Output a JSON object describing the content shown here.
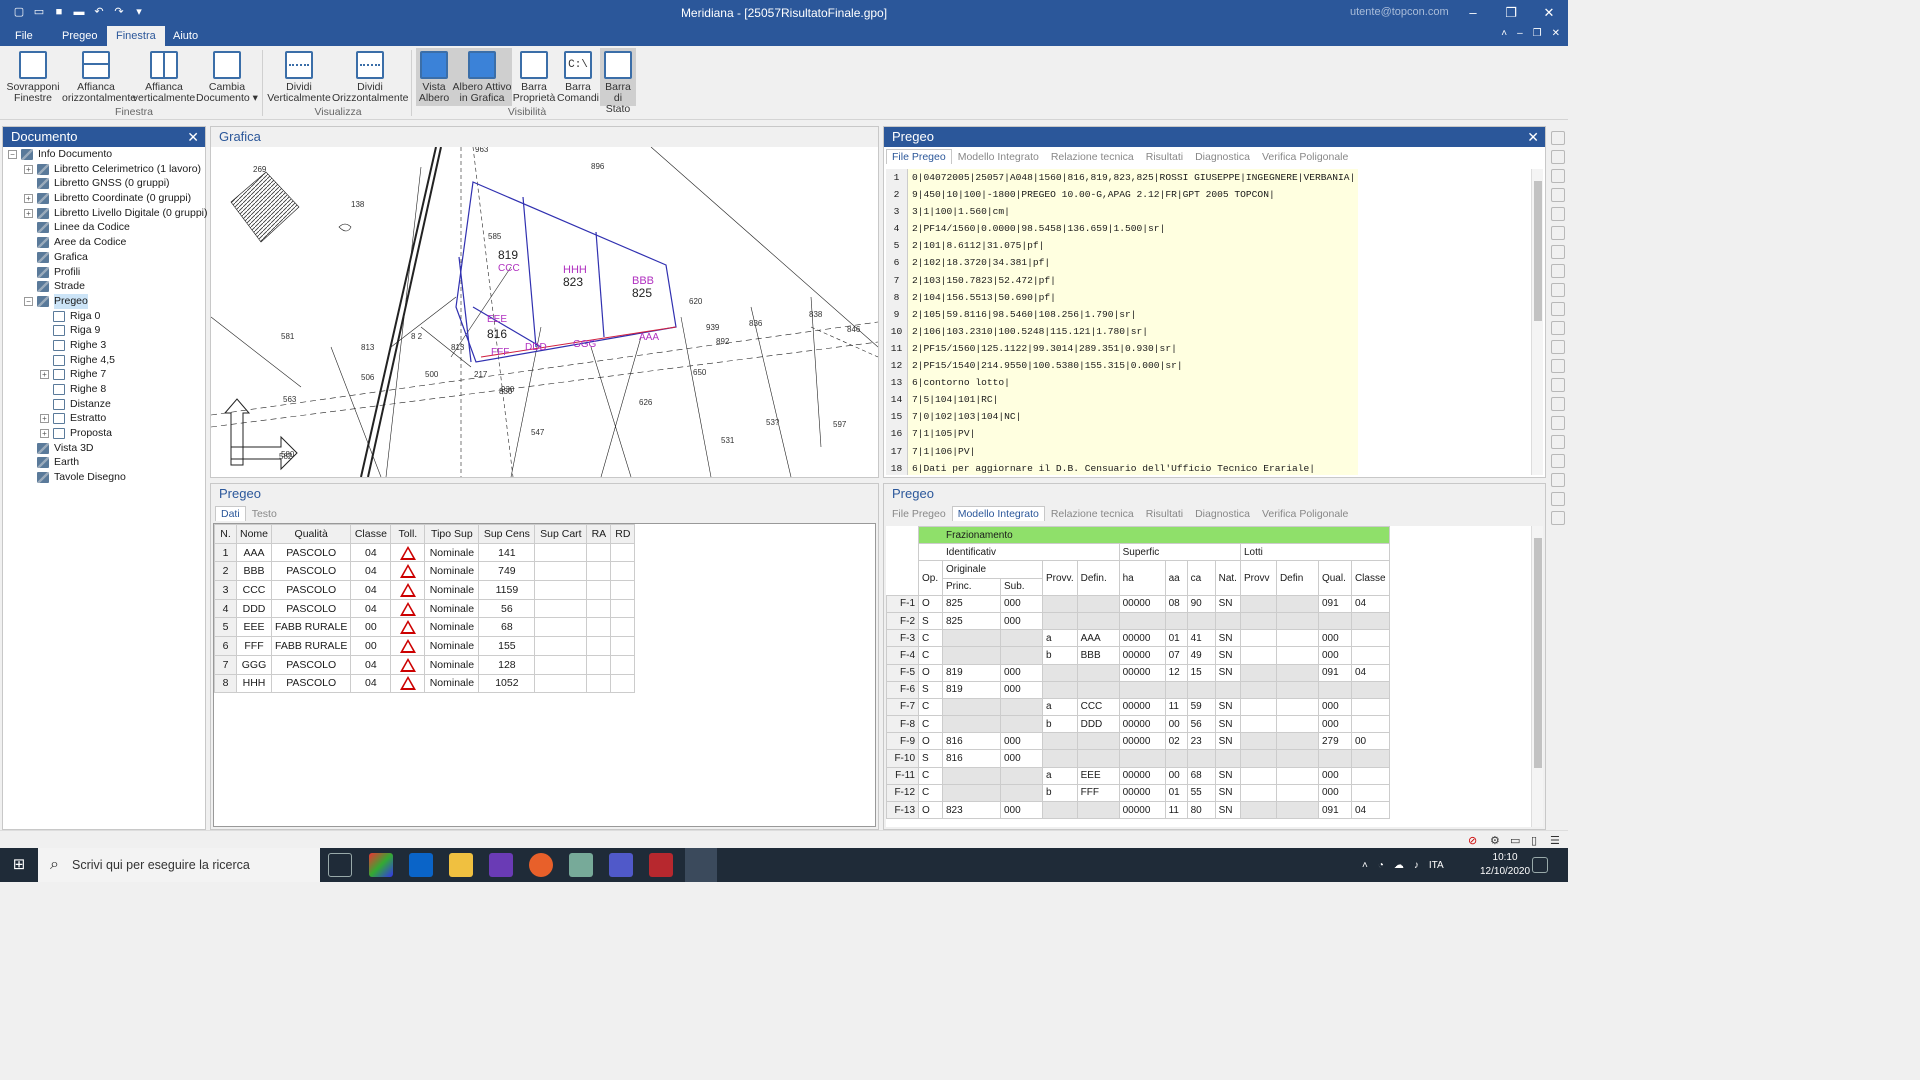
{
  "window": {
    "title": "Meridiana - [25057RisultatoFinale.gpo]",
    "user": "utente@topcon.com"
  },
  "menu": {
    "tabs": [
      "File",
      "Pregeo",
      "Finestra",
      "Aiuto"
    ]
  },
  "ribbon": {
    "buttons": [
      {
        "label": "Sovrapponi\nFinestre"
      },
      {
        "label": "Affianca\norizzontalmente"
      },
      {
        "label": "Affianca\nverticalmente"
      },
      {
        "label": "Cambia\nDocumento ▾"
      },
      {
        "label": "Dividi\nVerticalmente"
      },
      {
        "label": "Dividi\nOrizzontalmente"
      },
      {
        "label": "Vista\nAlbero"
      },
      {
        "label": "Albero Attivo\nin Grafica"
      },
      {
        "label": "Barra\nProprietà"
      },
      {
        "label": "Barra\nComandi"
      },
      {
        "label": "Barra di\nStato"
      }
    ],
    "groups": [
      "Finestra",
      "Visualizza",
      "Visibilità"
    ],
    "cmd_icon_text": "C:\\"
  },
  "document_panel": {
    "title": "Documento",
    "tree": [
      {
        "label": "Info Documento",
        "level": 0,
        "toggle": "−"
      },
      {
        "label": "Libretto Celerimetrico (1 lavoro)",
        "level": 1,
        "toggle": "+"
      },
      {
        "label": "Libretto GNSS (0 gruppi)",
        "level": 1,
        "toggle": ""
      },
      {
        "label": "Libretto Coordinate (0 gruppi)",
        "level": 1,
        "toggle": "+"
      },
      {
        "label": "Libretto Livello Digitale (0 gruppi)",
        "level": 1,
        "toggle": "+"
      },
      {
        "label": "Linee da Codice",
        "level": 1,
        "toggle": ""
      },
      {
        "label": "Aree da Codice",
        "level": 1,
        "toggle": ""
      },
      {
        "label": "Grafica",
        "level": 1,
        "toggle": ""
      },
      {
        "label": "Profili",
        "level": 1,
        "toggle": ""
      },
      {
        "label": "Strade",
        "level": 1,
        "toggle": ""
      },
      {
        "label": "Pregeo",
        "level": 1,
        "toggle": "−",
        "selected": true
      },
      {
        "label": "Riga 0",
        "level": 2,
        "toggle": ""
      },
      {
        "label": "Riga 9",
        "level": 2,
        "toggle": ""
      },
      {
        "label": "Righe 3",
        "level": 2,
        "toggle": ""
      },
      {
        "label": "Righe 4,5",
        "level": 2,
        "toggle": ""
      },
      {
        "label": "Righe 7",
        "level": 2,
        "toggle": "+"
      },
      {
        "label": "Righe 8",
        "level": 2,
        "toggle": ""
      },
      {
        "label": "Distanze",
        "level": 2,
        "toggle": ""
      },
      {
        "label": "Estratto",
        "level": 2,
        "toggle": "+"
      },
      {
        "label": "Proposta",
        "level": 2,
        "toggle": "+"
      },
      {
        "label": "Vista 3D",
        "level": 1,
        "toggle": ""
      },
      {
        "label": "Earth",
        "level": 1,
        "toggle": ""
      },
      {
        "label": "Tavole Disegno",
        "level": 1,
        "toggle": ""
      }
    ]
  },
  "grafica": {
    "title": "Grafica",
    "parcels": [
      "819",
      "823",
      "825",
      "816"
    ],
    "parcel_labels": [
      "CCC",
      "HHH",
      "BBB",
      "EEE",
      "FFF",
      "DDD",
      "GGG",
      "AAA"
    ],
    "map_numbers": [
      "269",
      "138",
      "563",
      "963",
      "581",
      "580",
      "813",
      "506",
      "585",
      "500",
      "813",
      "896",
      "930",
      "620",
      "939",
      "836",
      "838",
      "846",
      "650",
      "626",
      "547",
      "531",
      "53?",
      "597",
      "582",
      "892",
      "217",
      "830",
      "8 2"
    ]
  },
  "pregeo_left": {
    "title": "Pregeo",
    "tabs": [
      "Dati",
      "Testo"
    ],
    "columns": [
      "N.",
      "Nome",
      "Qualità",
      "Classe",
      "Toll.",
      "Tipo Sup",
      "Sup Cens",
      "Sup Cart",
      "RA",
      "RD"
    ],
    "rows": [
      {
        "n": "1",
        "nome": "AAA",
        "qualita": "PASCOLO",
        "classe": "04",
        "tipo": "Nominale",
        "sup": "141"
      },
      {
        "n": "2",
        "nome": "BBB",
        "qualita": "PASCOLO",
        "classe": "04",
        "tipo": "Nominale",
        "sup": "749"
      },
      {
        "n": "3",
        "nome": "CCC",
        "qualita": "PASCOLO",
        "classe": "04",
        "tipo": "Nominale",
        "sup": "1159"
      },
      {
        "n": "4",
        "nome": "DDD",
        "qualita": "PASCOLO",
        "classe": "04",
        "tipo": "Nominale",
        "sup": "56"
      },
      {
        "n": "5",
        "nome": "EEE",
        "qualita": "FABB RURALE",
        "classe": "00",
        "tipo": "Nominale",
        "sup": "68"
      },
      {
        "n": "6",
        "nome": "FFF",
        "qualita": "FABB RURALE",
        "classe": "00",
        "tipo": "Nominale",
        "sup": "155"
      },
      {
        "n": "7",
        "nome": "GGG",
        "qualita": "PASCOLO",
        "classe": "04",
        "tipo": "Nominale",
        "sup": "128"
      },
      {
        "n": "8",
        "nome": "HHH",
        "qualita": "PASCOLO",
        "classe": "04",
        "tipo": "Nominale",
        "sup": "1052"
      }
    ]
  },
  "pregeo_top": {
    "title": "Pregeo",
    "tabs": [
      "File Pregeo",
      "Modello Integrato",
      "Relazione tecnica",
      "Risultati",
      "Diagnostica",
      "Verifica Poligonale"
    ],
    "lines": [
      "0|04072005|25057|A048|1560|816,819,823,825|ROSSI GIUSEPPE|INGEGNERE|VERBANIA|",
      "9|450|10|100|-1800|PREGEO 10.00-G,APAG 2.12|FR|GPT 2005 TOPCON|",
      "3|1|100|1.560|cm|",
      "2|PF14/1560|0.0000|98.5458|136.659|1.500|sr|",
      "2|101|8.6112|31.075|pf|",
      "2|102|18.3720|34.381|pf|",
      "2|103|150.7823|52.472|pf|",
      "2|104|156.5513|50.690|pf|",
      "2|105|59.8116|98.5460|108.256|1.790|sr|",
      "2|106|103.2310|100.5248|115.121|1.780|sr|",
      "2|PF15/1560|125.1122|99.3014|289.351|0.930|sr|",
      "2|PF15/1540|214.9550|100.5380|155.315|0.000|sr|",
      "6|contorno lotto|",
      "7|5|104|101|RC|",
      "7|0|102|103|104|NC|",
      "7|1|105|PV|",
      "7|1|106|PV|",
      "6|Dati per aggiornare il D.B. Censuario dell'Ufficio Tecnico Erariale|"
    ]
  },
  "pregeo_bottom": {
    "title": "Pregeo",
    "tabs": [
      "File Pregeo",
      "Modello Integrato",
      "Relazione tecnica",
      "Risultati",
      "Diagnostica",
      "Verifica Poligonale"
    ],
    "header": {
      "frazionamento": "Frazionamento",
      "identificativ": "Identificativ",
      "superfic": "Superfic",
      "lotti": "Lotti",
      "op": "Op.",
      "originale": "Originale",
      "princ": "Princ.",
      "sub": "Sub.",
      "provv": "Provv.",
      "defin": "Defin.",
      "ha": "ha",
      "aa": "aa",
      "ca": "ca",
      "nat": "Nat.",
      "lprovv": "Provv",
      "ldefin": "Defin",
      "qual": "Qual.",
      "classe": "Classe"
    },
    "rows": [
      {
        "id": "F-1",
        "op": "O",
        "princ": "825",
        "sub": "000",
        "provv": "",
        "defin": "",
        "ha": "00000",
        "aa": "08",
        "ca": "90",
        "nat": "SN",
        "qual": "091",
        "classe": "04"
      },
      {
        "id": "F-2",
        "op": "S",
        "princ": "825",
        "sub": "000",
        "provv": "",
        "defin": "",
        "ha": "",
        "aa": "",
        "ca": "",
        "nat": "",
        "qual": "",
        "classe": ""
      },
      {
        "id": "F-3",
        "op": "C",
        "princ": "",
        "sub": "",
        "provv": "a",
        "defin": "AAA",
        "ha": "00000",
        "aa": "01",
        "ca": "41",
        "nat": "SN",
        "qual": "000",
        "classe": ""
      },
      {
        "id": "F-4",
        "op": "C",
        "princ": "",
        "sub": "",
        "provv": "b",
        "defin": "BBB",
        "ha": "00000",
        "aa": "07",
        "ca": "49",
        "nat": "SN",
        "qual": "000",
        "classe": ""
      },
      {
        "id": "F-5",
        "op": "O",
        "princ": "819",
        "sub": "000",
        "provv": "",
        "defin": "",
        "ha": "00000",
        "aa": "12",
        "ca": "15",
        "nat": "SN",
        "qual": "091",
        "classe": "04"
      },
      {
        "id": "F-6",
        "op": "S",
        "princ": "819",
        "sub": "000",
        "provv": "",
        "defin": "",
        "ha": "",
        "aa": "",
        "ca": "",
        "nat": "",
        "qual": "",
        "classe": ""
      },
      {
        "id": "F-7",
        "op": "C",
        "princ": "",
        "sub": "",
        "provv": "a",
        "defin": "CCC",
        "ha": "00000",
        "aa": "11",
        "ca": "59",
        "nat": "SN",
        "qual": "000",
        "classe": ""
      },
      {
        "id": "F-8",
        "op": "C",
        "princ": "",
        "sub": "",
        "provv": "b",
        "defin": "DDD",
        "ha": "00000",
        "aa": "00",
        "ca": "56",
        "nat": "SN",
        "qual": "000",
        "classe": ""
      },
      {
        "id": "F-9",
        "op": "O",
        "princ": "816",
        "sub": "000",
        "provv": "",
        "defin": "",
        "ha": "00000",
        "aa": "02",
        "ca": "23",
        "nat": "SN",
        "qual": "279",
        "classe": "00"
      },
      {
        "id": "F-10",
        "op": "S",
        "princ": "816",
        "sub": "000",
        "provv": "",
        "defin": "",
        "ha": "",
        "aa": "",
        "ca": "",
        "nat": "",
        "qual": "",
        "classe": ""
      },
      {
        "id": "F-11",
        "op": "C",
        "princ": "",
        "sub": "",
        "provv": "a",
        "defin": "EEE",
        "ha": "00000",
        "aa": "00",
        "ca": "68",
        "nat": "SN",
        "qual": "000",
        "classe": ""
      },
      {
        "id": "F-12",
        "op": "C",
        "princ": "",
        "sub": "",
        "provv": "b",
        "defin": "FFF",
        "ha": "00000",
        "aa": "01",
        "ca": "55",
        "nat": "SN",
        "qual": "000",
        "classe": ""
      },
      {
        "id": "F-13",
        "op": "O",
        "princ": "823",
        "sub": "000",
        "provv": "",
        "defin": "",
        "ha": "00000",
        "aa": "11",
        "ca": "80",
        "nat": "SN",
        "qual": "091",
        "classe": "04"
      }
    ]
  },
  "taskbar": {
    "search_placeholder": "Scrivi qui per eseguire la ricerca",
    "lang": "ITA",
    "time": "10:10",
    "date": "12/10/2020"
  },
  "colors": {
    "accent": "#2b579a",
    "code_bg": "#ffffe0",
    "header_green": "#8fe06a",
    "parcel_outline": "#3030b0",
    "parcel_label": "#b030c0"
  }
}
